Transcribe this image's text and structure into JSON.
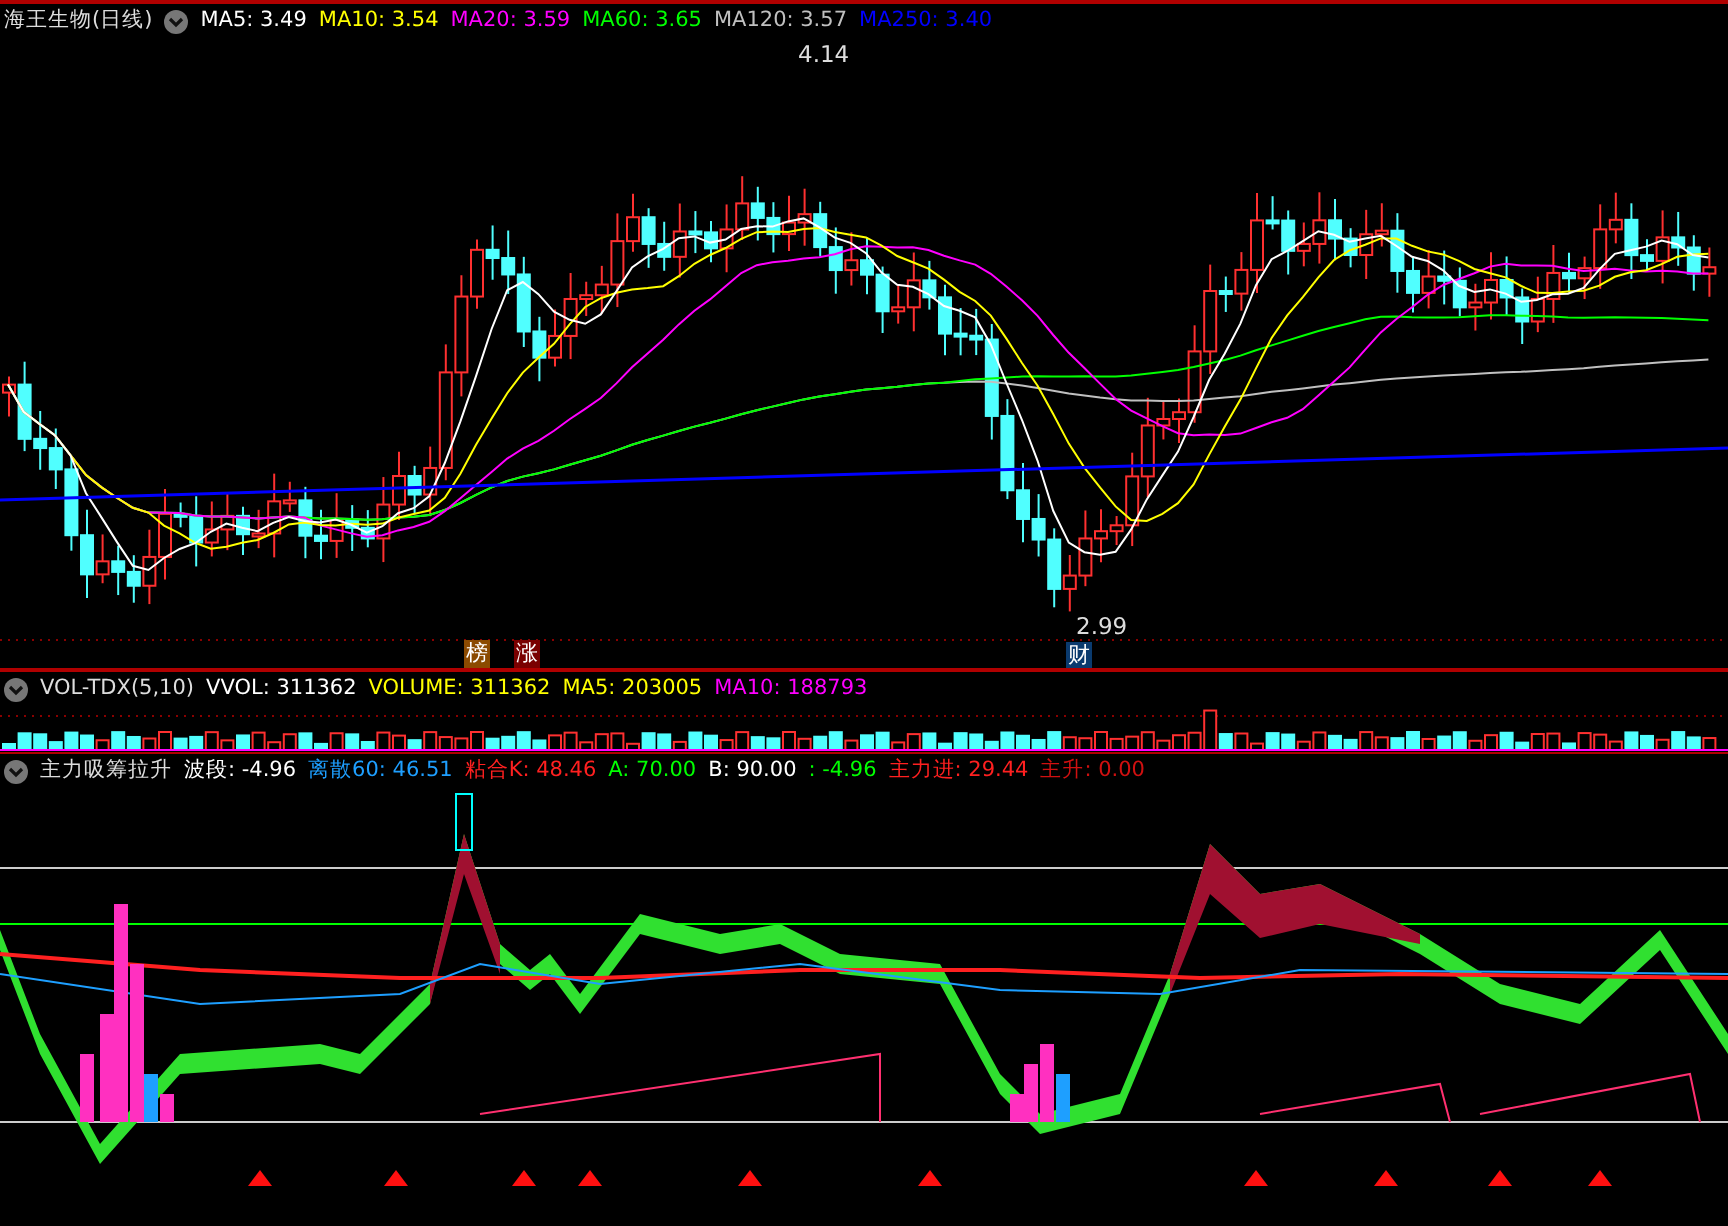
{
  "price_panel": {
    "title": "海王生物(日线)",
    "legend": [
      {
        "label": "MA5:",
        "value": "3.49",
        "color": "#ffffff"
      },
      {
        "label": "MA10:",
        "value": "3.54",
        "color": "#ffff00"
      },
      {
        "label": "MA20:",
        "value": "3.59",
        "color": "#ff00ff"
      },
      {
        "label": "MA60:",
        "value": "3.65",
        "color": "#00ff00"
      },
      {
        "label": "MA120:",
        "value": "3.57",
        "color": "#c0c0c0"
      },
      {
        "label": "MA250:",
        "value": "3.40",
        "color": "#0000ff"
      }
    ],
    "high_label": "4.14",
    "low_label": "2.99",
    "badges": [
      {
        "text": "榜",
        "color": "#8b4a00"
      },
      {
        "text": "涨",
        "color": "#7a0000"
      },
      {
        "text": "财",
        "color": "#0a3a6e"
      }
    ]
  },
  "volume_panel": {
    "title": "VOL-TDX(5,10)",
    "legend": [
      {
        "label": "VVOL:",
        "value": "311362",
        "color": "#ffffff"
      },
      {
        "label": "VOLUME:",
        "value": "311362",
        "color": "#ffff00"
      },
      {
        "label": "MA5:",
        "value": "203005",
        "color": "#ffff00"
      },
      {
        "label": "MA10:",
        "value": "188793",
        "color": "#ff00ff"
      }
    ]
  },
  "indicator_panel": {
    "title": "主力吸筹拉升",
    "legend": [
      {
        "label": "波段:",
        "value": "-4.96",
        "color": "#ffffff"
      },
      {
        "label": "离散60:",
        "value": "46.51",
        "color": "#1e9fff"
      },
      {
        "label": "粘合K:",
        "value": "48.46",
        "color": "#ff2020"
      },
      {
        "label": "A:",
        "value": "70.00",
        "color": "#00ff00"
      },
      {
        "label": "B:",
        "value": "90.00",
        "color": "#ffffff"
      },
      {
        "label": ":",
        "value": "-4.96",
        "color": "#00ff00"
      },
      {
        "label": "主力进:",
        "value": "29.44",
        "color": "#ff2020"
      },
      {
        "label": "主升:",
        "value": "0.00",
        "color": "#d01010"
      }
    ]
  }
}
